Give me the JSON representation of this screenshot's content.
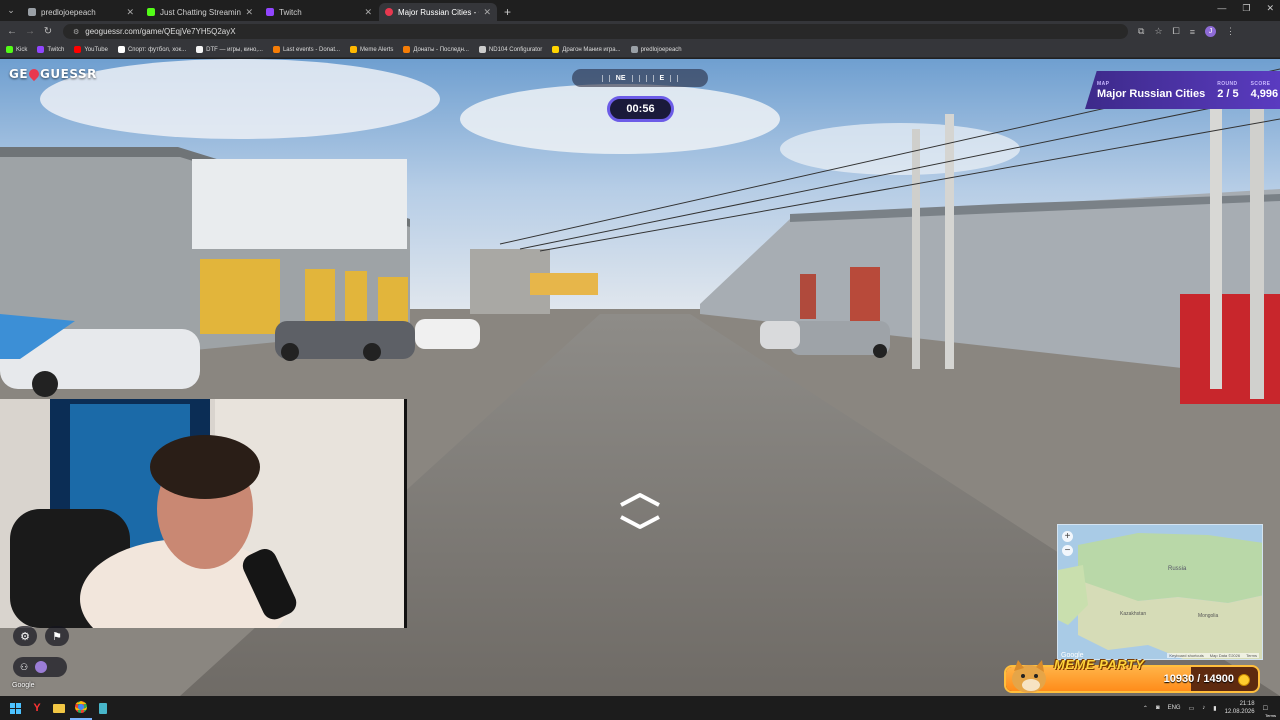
{
  "browser": {
    "tabs": [
      {
        "title": "predlojoepeach",
        "color": "#9aa0a6",
        "active": false
      },
      {
        "title": "Just Chatting Streaming - Live",
        "color": "#53fc18",
        "active": false
      },
      {
        "title": "Twitch",
        "color": "#9146ff",
        "active": false
      },
      {
        "title": "Major Russian Cities - Game",
        "color": "#e8384f",
        "active": true
      }
    ],
    "url": "geoguessr.com/game/QEqjVe7YH5Q2ayX",
    "profile_initial": "J",
    "bookmarks": [
      {
        "label": "Kick",
        "color": "#53fc18"
      },
      {
        "label": "Twitch",
        "color": "#9146ff"
      },
      {
        "label": "YouTube",
        "color": "#ff0000"
      },
      {
        "label": "Спорт: футбол, хок...",
        "color": "#ffffff"
      },
      {
        "label": "DTF — игры, кино,...",
        "color": "#f5f5f5"
      },
      {
        "label": "Last events - Donat...",
        "color": "#f57d07"
      },
      {
        "label": "Meme Alerts",
        "color": "#ffb800"
      },
      {
        "label": "Донаты - Последн...",
        "color": "#f57d07"
      },
      {
        "label": "ND104 Configurator",
        "color": "#cccccc"
      },
      {
        "label": "Драгон Мания игра...",
        "color": "#ffd400"
      },
      {
        "label": "predlojoepeach",
        "color": "#9aa0a6"
      }
    ]
  },
  "game": {
    "logo_left": "GE",
    "logo_right": "GUESSR",
    "compass": {
      "left": "NE",
      "right": "E"
    },
    "timer": "00:56",
    "map_label": "MAP",
    "map_name": "Major Russian Cities",
    "round_label": "ROUND",
    "round_value": "2 / 5",
    "score_label": "SCORE",
    "score_value": "4,996",
    "google_mark": "Google",
    "minimap": {
      "labels": [
        "Kazakhstan",
        "Mongolia",
        "Russia"
      ],
      "footer": [
        "Keyboard shortcuts",
        "Map Data ©2026",
        "Terms"
      ],
      "google": "Google"
    }
  },
  "overlay": {
    "meme_title": "MEME PARTY",
    "meme_count": "10930 / 14900",
    "meme_progress": 0.7336
  },
  "taskbar": {
    "lang": "ENG",
    "time": "21:18",
    "date": "12.08.2026",
    "terms": "Terms"
  }
}
